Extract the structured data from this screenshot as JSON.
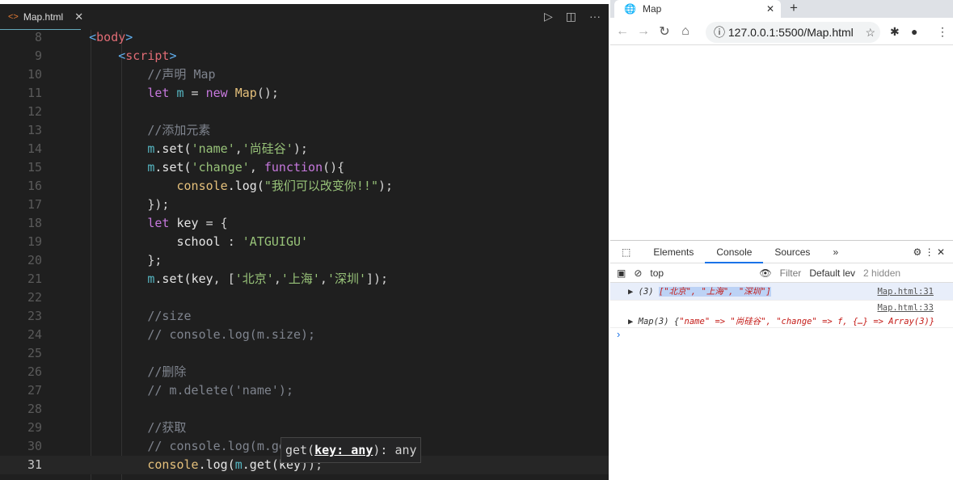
{
  "editor": {
    "tab": "Map.html",
    "tab_icon": "<>",
    "close": "✕",
    "lines": [
      {
        "n": "8",
        "t": [
          [
            "    ",
            "pl"
          ],
          [
            "<",
            "br"
          ],
          [
            "body",
            "tag"
          ],
          [
            ">",
            "br"
          ]
        ]
      },
      {
        "n": "9",
        "t": [
          [
            "        ",
            "pl"
          ],
          [
            "<",
            "br"
          ],
          [
            "script",
            "tag"
          ],
          [
            ">",
            "br"
          ]
        ]
      },
      {
        "n": "10",
        "t": [
          [
            "            ",
            "pl"
          ],
          [
            "//声明 Map",
            "cm"
          ]
        ]
      },
      {
        "n": "11",
        "t": [
          [
            "            ",
            "pl"
          ],
          [
            "let ",
            "kw"
          ],
          [
            "m",
            "var"
          ],
          [
            " = ",
            "pl"
          ],
          [
            "new ",
            "kw"
          ],
          [
            "Map",
            "fn"
          ],
          [
            "();",
            "pl"
          ]
        ]
      },
      {
        "n": "12",
        "t": []
      },
      {
        "n": "13",
        "t": [
          [
            "            ",
            "pl"
          ],
          [
            "//添加元素",
            "cm"
          ]
        ]
      },
      {
        "n": "14",
        "t": [
          [
            "            ",
            "pl"
          ],
          [
            "m",
            "var"
          ],
          [
            ".set(",
            "pr"
          ],
          [
            "'name'",
            "str"
          ],
          [
            ",",
            "pl"
          ],
          [
            "'尚硅谷'",
            "str"
          ],
          [
            ");",
            "pl"
          ]
        ]
      },
      {
        "n": "15",
        "t": [
          [
            "            ",
            "pl"
          ],
          [
            "m",
            "var"
          ],
          [
            ".set(",
            "pr"
          ],
          [
            "'change'",
            "str"
          ],
          [
            ", ",
            "pl"
          ],
          [
            "function",
            "kw"
          ],
          [
            "(){",
            "pl"
          ]
        ]
      },
      {
        "n": "16",
        "t": [
          [
            "                ",
            "pl"
          ],
          [
            "console",
            "fn"
          ],
          [
            ".log(",
            "pr"
          ],
          [
            "\"我们可以改变你!!\"",
            "str"
          ],
          [
            ");",
            "pl"
          ]
        ]
      },
      {
        "n": "17",
        "t": [
          [
            "            ",
            "pl"
          ],
          [
            "});",
            "pl"
          ]
        ]
      },
      {
        "n": "18",
        "t": [
          [
            "            ",
            "pl"
          ],
          [
            "let ",
            "kw"
          ],
          [
            "key",
            "pr"
          ],
          [
            " = {",
            "pl"
          ]
        ]
      },
      {
        "n": "19",
        "t": [
          [
            "                ",
            "pl"
          ],
          [
            "school",
            "pr"
          ],
          [
            " : ",
            "pl"
          ],
          [
            "'ATGUIGU'",
            "str"
          ]
        ]
      },
      {
        "n": "20",
        "t": [
          [
            "            ",
            "pl"
          ],
          [
            "};",
            "pl"
          ]
        ]
      },
      {
        "n": "21",
        "t": [
          [
            "            ",
            "pl"
          ],
          [
            "m",
            "var"
          ],
          [
            ".set(",
            "pr"
          ],
          [
            "key",
            "pr"
          ],
          [
            ", [",
            "pl"
          ],
          [
            "'北京'",
            "str"
          ],
          [
            ",",
            "pl"
          ],
          [
            "'上海'",
            "str"
          ],
          [
            ",",
            "pl"
          ],
          [
            "'深圳'",
            "str"
          ],
          [
            "]);",
            "pl"
          ]
        ]
      },
      {
        "n": "22",
        "t": []
      },
      {
        "n": "23",
        "t": [
          [
            "            ",
            "pl"
          ],
          [
            "//size",
            "cm"
          ]
        ]
      },
      {
        "n": "24",
        "t": [
          [
            "            ",
            "pl"
          ],
          [
            "// console.log(m.size);",
            "cm"
          ]
        ]
      },
      {
        "n": "25",
        "t": []
      },
      {
        "n": "26",
        "t": [
          [
            "            ",
            "pl"
          ],
          [
            "//删除",
            "cm"
          ]
        ]
      },
      {
        "n": "27",
        "t": [
          [
            "            ",
            "pl"
          ],
          [
            "// m.delete('name');",
            "cm"
          ]
        ]
      },
      {
        "n": "28",
        "t": []
      },
      {
        "n": "29",
        "t": [
          [
            "            ",
            "pl"
          ],
          [
            "//获取",
            "cm"
          ]
        ]
      },
      {
        "n": "30",
        "t": [
          [
            "            ",
            "pl"
          ],
          [
            "// console.log(m.get(",
            "cm"
          ]
        ]
      },
      {
        "n": "31",
        "t": [
          [
            "            ",
            "pl"
          ],
          [
            "console",
            "fn"
          ],
          [
            ".log(",
            "pr"
          ],
          [
            "m",
            "var"
          ],
          [
            ".get(",
            "pr"
          ],
          [
            "key",
            "pr"
          ],
          [
            "));",
            "pl"
          ]
        ]
      }
    ],
    "tooltip": {
      "pre": "get(",
      "param": "key: any",
      "post": "): any"
    }
  },
  "browser": {
    "tab_title": "Map",
    "url": "127.0.0.1:5500/Map.html",
    "devtools": {
      "tabs": [
        "Elements",
        "Console",
        "Sources",
        "»"
      ],
      "context": "top",
      "filter": "Filter",
      "level": "Default lev",
      "hidden": "2 hidden",
      "messages": [
        {
          "prefix": "▶ (3) ",
          "value": "[\"北京\", \"上海\", \"深圳\"]",
          "source": "Map.html:31"
        },
        {
          "prefix": "▶ Map(3) {",
          "value": "\"name\" => \"尚硅谷\", \"change\" => f, {…} => Array(3)}",
          "source": "Map.html:33"
        }
      ],
      "prompt": "›"
    }
  }
}
